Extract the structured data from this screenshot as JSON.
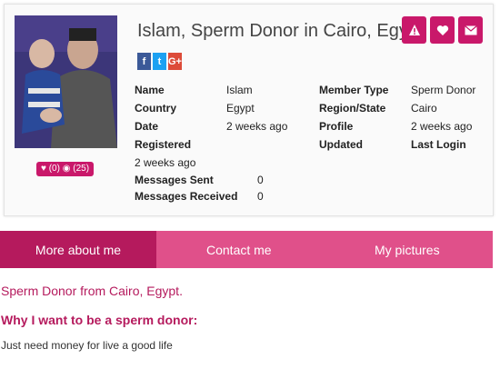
{
  "profile": {
    "title": "Islam, Sperm Donor in Cairo, Egypt",
    "likes": "(0)",
    "views": "(25)"
  },
  "actions": {
    "report_icon": "warning-icon",
    "favorite_icon": "heart-icon",
    "message_icon": "envelope-icon"
  },
  "social": {
    "facebook": "f",
    "twitter": "t",
    "google": "G+"
  },
  "info": {
    "name_label": "Name",
    "name_value": "Islam",
    "country_label": "Country",
    "country_value": "Egypt",
    "date_label": "Date",
    "date_value": "2 weeks ago",
    "registered_label": "Registered",
    "registered_value": "2 weeks ago",
    "messages_sent_label": "Messages Sent",
    "messages_sent_value": "0",
    "messages_received_label": "Messages Received",
    "messages_received_value": "0",
    "member_type_label": "Member Type",
    "member_type_value": "Sperm Donor",
    "region_label": "Region/State",
    "region_value": "Cairo",
    "profile_label": "Profile",
    "profile_value": "2 weeks ago",
    "updated_label": "Updated",
    "last_login_label": "Last Login"
  },
  "tabs": [
    "More about me",
    "Contact me",
    "My pictures"
  ],
  "content": {
    "intro": "Sperm Donor from Cairo, Egypt.",
    "why_heading": "Why I want to be a sperm donor:",
    "answer": "Just need money for live a good life"
  },
  "colors": {
    "accent": "#c9186a",
    "tab_bar": "#e0508a",
    "tab_active": "#b51a5d"
  }
}
